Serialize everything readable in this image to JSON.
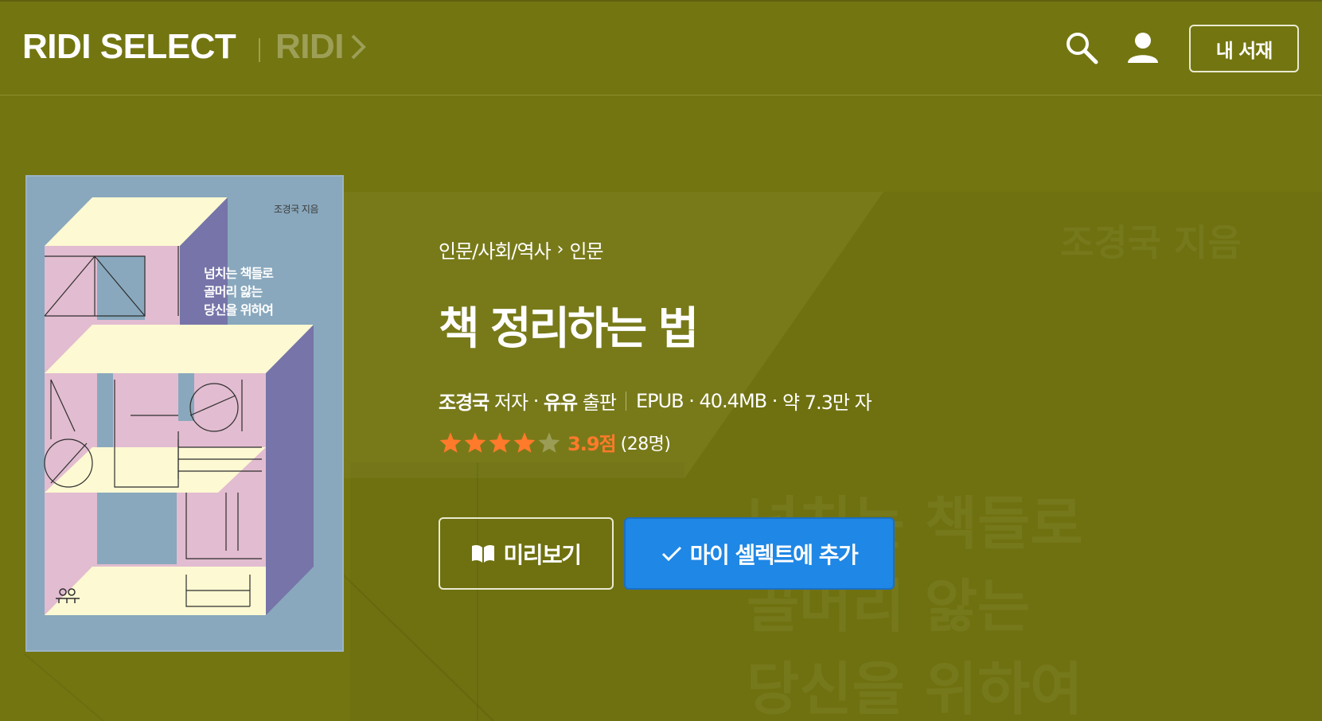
{
  "header": {
    "brand": "RIDI SELECT",
    "ridi_link": "RIDI",
    "my_library": "내 서재",
    "search_icon": "search-icon",
    "user_icon": "user-icon"
  },
  "book": {
    "breadcrumb": [
      "인문/사회/역사",
      "인문"
    ],
    "title": "책 정리하는 법",
    "author": "조경국",
    "author_role": "저자",
    "publisher": "유유",
    "publisher_role": "출판",
    "format": "EPUB",
    "size": "40.4MB",
    "length": "약 7.3만 자",
    "rating": "3.9점",
    "rating_value": 3.9,
    "rating_count": "(28명)"
  },
  "cover": {
    "author_text": "조경국 지음",
    "subtitle": "넘치는 책들로\n골머리 앓는\n당신을 위하여"
  },
  "background_text": {
    "author": "조경국 지음",
    "line1": "넘치는 책들로",
    "line2": "골머리 앓는",
    "line3": "당신을 위하여"
  },
  "actions": {
    "preview": "미리보기",
    "add": "마이 셀렉트에 추가"
  },
  "colors": {
    "background": "#737511",
    "primary_button": "#1f87e5",
    "rating": "#ff7a2a"
  }
}
